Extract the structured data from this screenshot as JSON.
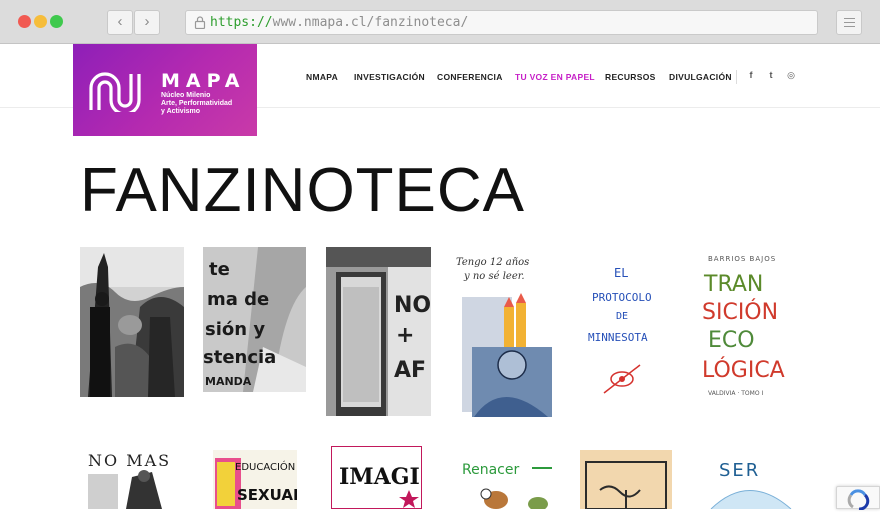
{
  "browser": {
    "url_protocol": "https://",
    "url_rest": "www.nmapa.cl/fanzinoteca/",
    "back_icon": "chevron-left-icon",
    "forward_icon": "chevron-right-icon",
    "lock_icon": "lock-icon",
    "menu_icon": "menu-icon"
  },
  "logo": {
    "brand": "MAPA",
    "subtitle_lines": [
      "Núcleo Milenio",
      "Arte, Performatividad",
      "y Activismo"
    ],
    "colors": [
      "#8e1fb8",
      "#c93aa8"
    ]
  },
  "nav": {
    "items": [
      {
        "label": "NMAPA",
        "active": false
      },
      {
        "label": "INVESTIGACIÓN",
        "active": false
      },
      {
        "label": "CONFERENCIA",
        "active": false
      },
      {
        "label": "TU VOZ EN PAPEL",
        "active": true
      },
      {
        "label": "RECURSOS",
        "active": false
      },
      {
        "label": "DIVULGACIÓN",
        "active": false
      }
    ],
    "social": [
      "facebook-icon",
      "twitter-icon",
      "instagram-icon"
    ],
    "social_glyphs": [
      "f",
      "t",
      "◎"
    ],
    "active_color": "#c61ec7"
  },
  "page": {
    "title": "FANZINOTECA"
  },
  "fanzines_row1": [
    {
      "name": "protest-photo-fanzine"
    },
    {
      "name": "graffiti-wall-fanzine",
      "text": [
        "te",
        "ma de",
        "sión y",
        "stencia",
        "MANDA"
      ]
    },
    {
      "name": "graffiti-door-fanzine",
      "text": [
        "NO",
        "+",
        "AF"
      ]
    },
    {
      "name": "tengo-12-anos-fanzine",
      "text": [
        "Tengo 12 años",
        "y no sé leer."
      ]
    },
    {
      "name": "protocolo-minnesota-fanzine",
      "text": [
        "EL",
        "PROTOCOLO",
        "DE",
        "MINNESOTA"
      ]
    },
    {
      "name": "transicion-ecologica-fanzine",
      "text": [
        "BARRIOS BAJOS",
        "TRAN",
        "SICIÓN",
        "ECO",
        "LÓGICA",
        "VALDIVIA · TOMO I"
      ]
    }
  ],
  "fanzines_row2": [
    {
      "name": "no-mas-fanzine",
      "text": [
        "NO MAS"
      ]
    },
    {
      "name": "educacion-sexual-fanzine",
      "text": [
        "EDUCACIÓN",
        "SEXUAL"
      ]
    },
    {
      "name": "imagina-fanzine",
      "text": [
        "IMAGI"
      ]
    },
    {
      "name": "renacer-fanzine",
      "text": [
        "Renacer"
      ]
    },
    {
      "name": "woodcut-fanzine"
    },
    {
      "name": "ser-fanzine",
      "text": [
        "SER"
      ]
    }
  ],
  "recaptcha_icon": "recaptcha-icon"
}
